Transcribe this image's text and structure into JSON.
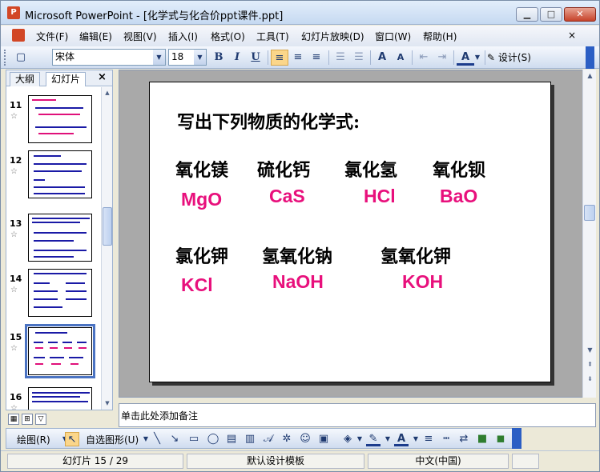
{
  "window": {
    "app_icon": "powerpoint-icon",
    "title": "Microsoft PowerPoint - [化学式与化合价ppt课件.ppt]",
    "controls": {
      "minimize": "▁",
      "maximize": "□",
      "close": "✕"
    }
  },
  "menu": {
    "items": [
      "文件(F)",
      "编辑(E)",
      "视图(V)",
      "插入(I)",
      "格式(O)",
      "工具(T)",
      "幻灯片放映(D)",
      "窗口(W)",
      "帮助(H)"
    ],
    "close_doc": "×"
  },
  "toolbar": {
    "font_name": "宋体",
    "font_size": "18",
    "bold": "B",
    "italic": "I",
    "underline": "U",
    "design_label": "设计(S)"
  },
  "outline_pane": {
    "tabs": [
      "大纲",
      "幻灯片"
    ],
    "close": "×",
    "slides": [
      {
        "number": "11",
        "selected": false
      },
      {
        "number": "12",
        "selected": false
      },
      {
        "number": "13",
        "selected": false
      },
      {
        "number": "14",
        "selected": false
      },
      {
        "number": "15",
        "selected": true
      },
      {
        "number": "16",
        "selected": false
      }
    ]
  },
  "slide": {
    "heading": "写出下列物质的化学式:",
    "row1": {
      "names": [
        "氧化镁",
        "硫化钙",
        "氯化氢",
        "氧化钡"
      ],
      "formulas": [
        "MgO",
        "CaS",
        "HCl",
        "BaO"
      ]
    },
    "row2": {
      "names": [
        "氯化钾",
        "氢氧化钠",
        "氢氧化钾"
      ],
      "formulas": [
        "KCl",
        "NaOH",
        "KOH"
      ]
    },
    "formula_color": "#e8107c"
  },
  "notes": {
    "placeholder": "单击此处添加备注"
  },
  "drawing_toolbar": {
    "draw_label": "绘图(R)",
    "autoshapes_label": "自选图形(U)"
  },
  "status": {
    "slide_position": "幻灯片 15 / 29",
    "template": "默认设计模板",
    "language": "中文(中国)"
  }
}
